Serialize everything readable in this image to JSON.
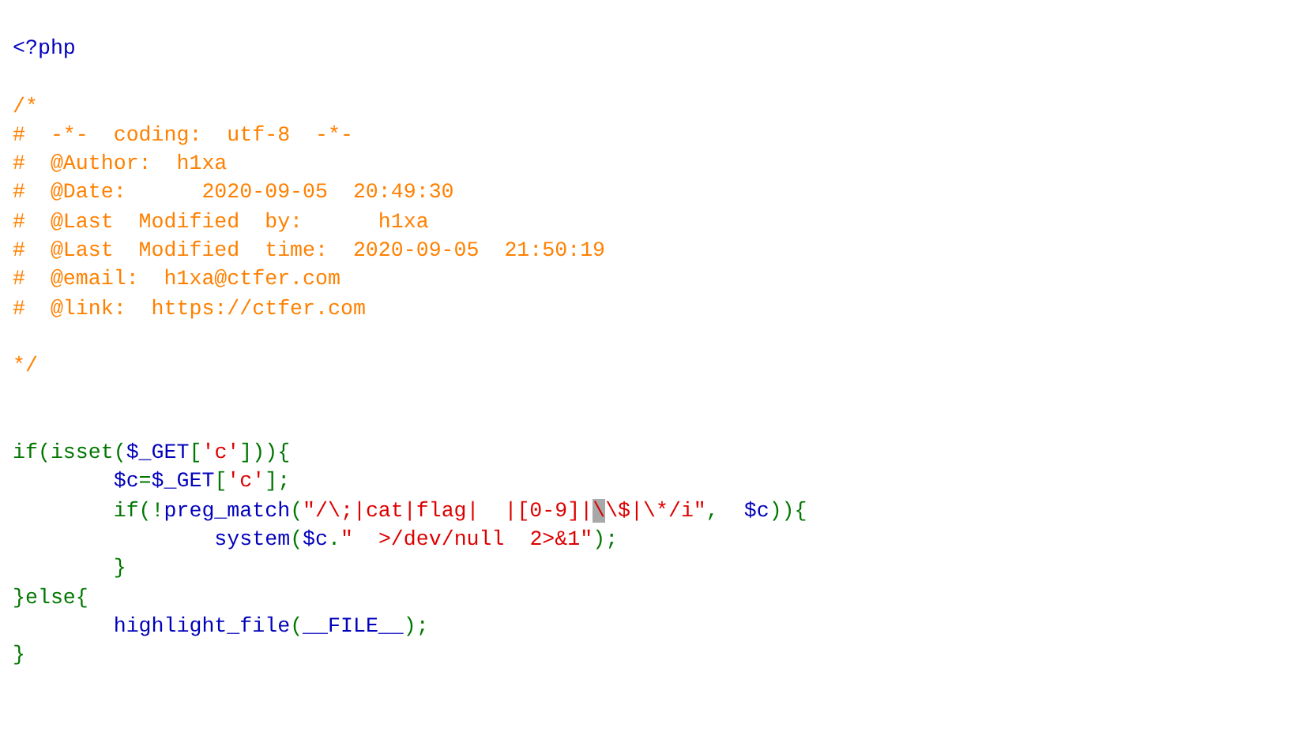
{
  "code_lines": [
    {
      "kind": "code",
      "tokens": [
        {
          "kind": "default",
          "text": "<?php"
        }
      ]
    },
    {
      "kind": "blank"
    },
    {
      "kind": "code",
      "tokens": [
        {
          "kind": "comment",
          "text": "/*"
        }
      ]
    },
    {
      "kind": "code",
      "tokens": [
        {
          "kind": "comment",
          "text": "#  -*-  coding:  utf-8  -*-"
        }
      ]
    },
    {
      "kind": "code",
      "tokens": [
        {
          "kind": "comment",
          "text": "#  @Author:  h1xa"
        }
      ]
    },
    {
      "kind": "code",
      "tokens": [
        {
          "kind": "comment",
          "text": "#  @Date:      2020-09-05  20:49:30"
        }
      ]
    },
    {
      "kind": "code",
      "tokens": [
        {
          "kind": "comment",
          "text": "#  @Last  Modified  by:      h1xa"
        }
      ]
    },
    {
      "kind": "code",
      "tokens": [
        {
          "kind": "comment",
          "text": "#  @Last  Modified  time:  2020-09-05  21:50:19"
        }
      ]
    },
    {
      "kind": "code",
      "tokens": [
        {
          "kind": "comment",
          "text": "#  @email:  h1xa@ctfer.com"
        }
      ]
    },
    {
      "kind": "code",
      "tokens": [
        {
          "kind": "comment",
          "text": "#  @link:  https://ctfer.com"
        }
      ]
    },
    {
      "kind": "blank"
    },
    {
      "kind": "code",
      "tokens": [
        {
          "kind": "comment",
          "text": "*/"
        }
      ]
    },
    {
      "kind": "blank"
    },
    {
      "kind": "blank"
    },
    {
      "kind": "code",
      "tokens": [
        {
          "kind": "keyword",
          "text": "if(isset("
        },
        {
          "kind": "default",
          "text": "$_GET"
        },
        {
          "kind": "keyword",
          "text": "["
        },
        {
          "kind": "string",
          "text": "'c'"
        },
        {
          "kind": "keyword",
          "text": "])){"
        }
      ]
    },
    {
      "kind": "code",
      "tokens": [
        {
          "kind": "default",
          "text": "        $c"
        },
        {
          "kind": "keyword",
          "text": "="
        },
        {
          "kind": "default",
          "text": "$_GET"
        },
        {
          "kind": "keyword",
          "text": "["
        },
        {
          "kind": "string",
          "text": "'c'"
        },
        {
          "kind": "keyword",
          "text": "];"
        }
      ]
    },
    {
      "kind": "code",
      "tokens": [
        {
          "kind": "keyword",
          "text": "        if(!"
        },
        {
          "kind": "default",
          "text": "preg_match"
        },
        {
          "kind": "keyword",
          "text": "("
        },
        {
          "kind": "string",
          "text": "\"/\\;|cat|flag|  |[0-9]|"
        },
        {
          "kind": "selected",
          "text": "\\"
        },
        {
          "kind": "string",
          "text": "\\$|\\*/i\""
        },
        {
          "kind": "keyword",
          "text": ",  "
        },
        {
          "kind": "default",
          "text": "$c"
        },
        {
          "kind": "keyword",
          "text": ")){"
        }
      ]
    },
    {
      "kind": "code",
      "tokens": [
        {
          "kind": "default",
          "text": "                system"
        },
        {
          "kind": "keyword",
          "text": "("
        },
        {
          "kind": "default",
          "text": "$c"
        },
        {
          "kind": "keyword",
          "text": "."
        },
        {
          "kind": "string",
          "text": "\"  >/dev/null  2>&1\""
        },
        {
          "kind": "keyword",
          "text": ");"
        }
      ]
    },
    {
      "kind": "code",
      "tokens": [
        {
          "kind": "keyword",
          "text": "        }"
        }
      ]
    },
    {
      "kind": "code",
      "tokens": [
        {
          "kind": "keyword",
          "text": "}else{"
        }
      ]
    },
    {
      "kind": "code",
      "tokens": [
        {
          "kind": "default",
          "text": "        highlight_file"
        },
        {
          "kind": "keyword",
          "text": "("
        },
        {
          "kind": "default",
          "text": "__FILE__"
        },
        {
          "kind": "keyword",
          "text": ");"
        }
      ]
    },
    {
      "kind": "code",
      "tokens": [
        {
          "kind": "keyword",
          "text": "}"
        }
      ]
    }
  ]
}
